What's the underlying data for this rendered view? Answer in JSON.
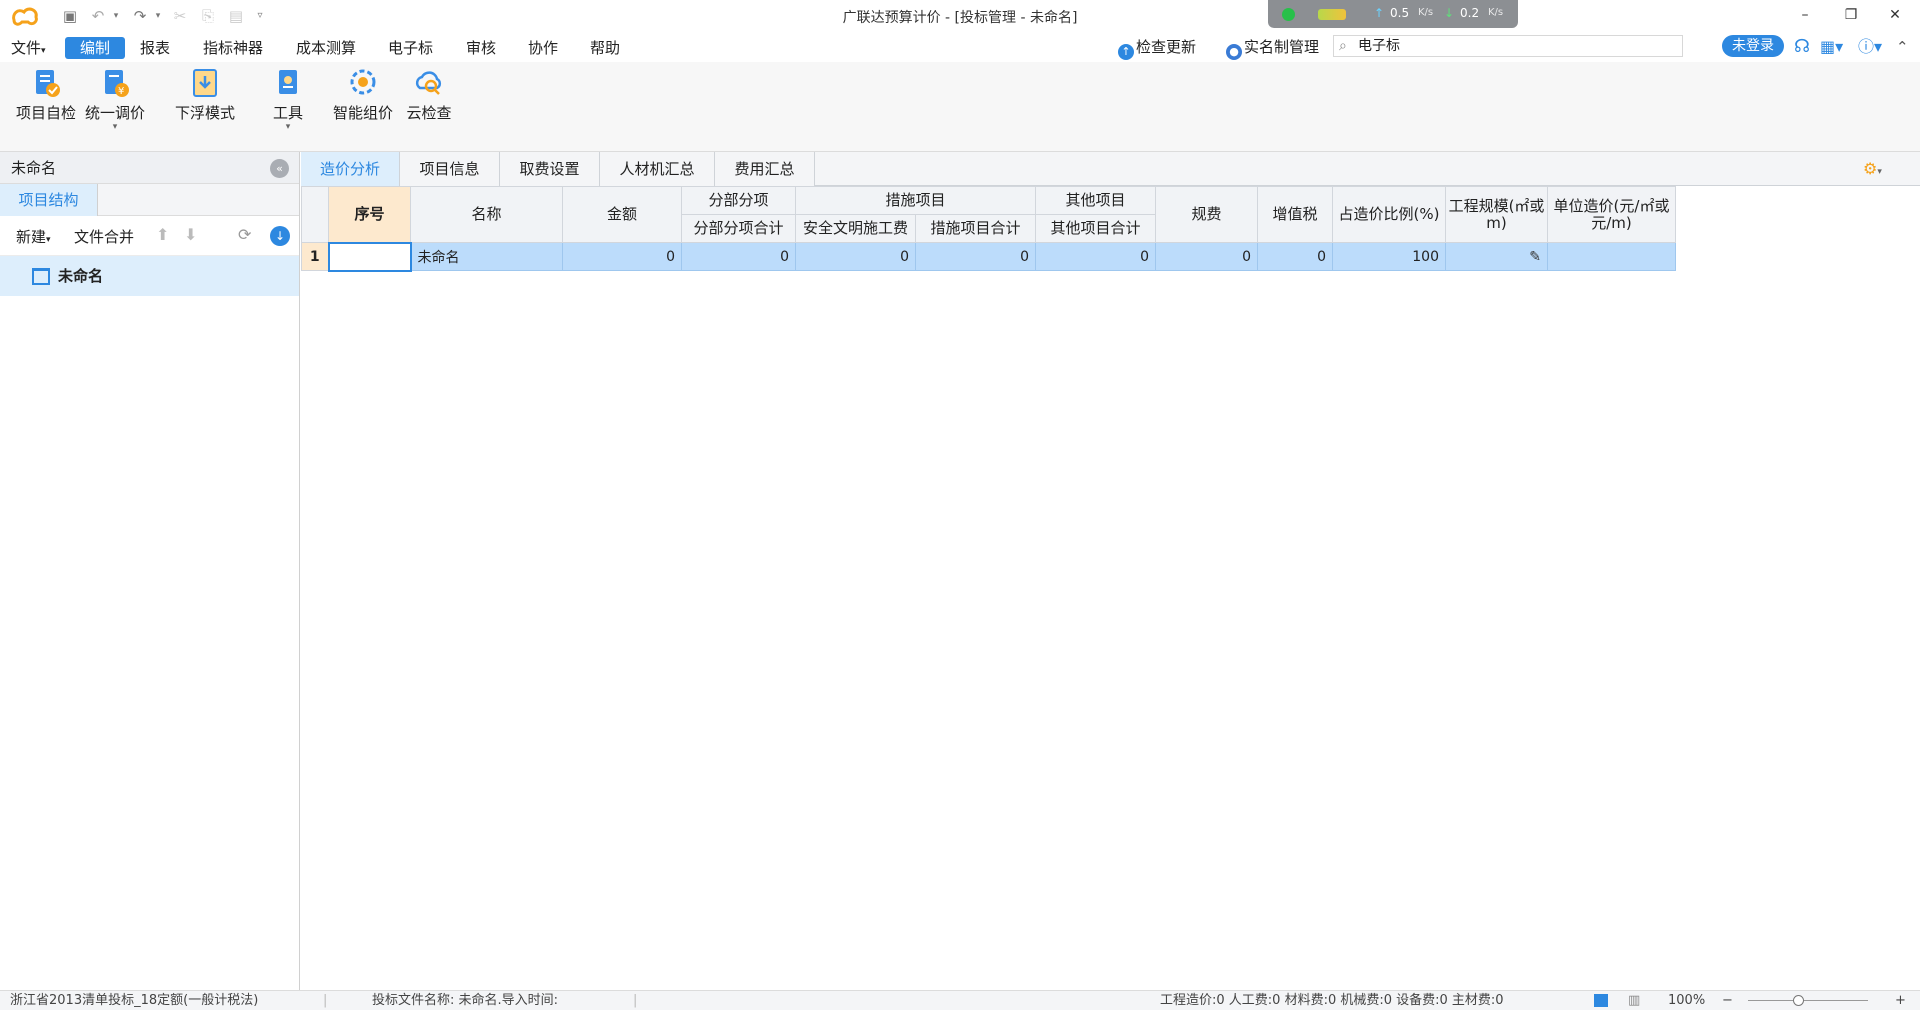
{
  "window": {
    "title": "广联达预算计价 - [投标管理 - 未命名]",
    "net_up": "0.5",
    "net_down": "0.2",
    "net_unit": "K/s"
  },
  "menus": [
    "文件",
    "编制",
    "报表",
    "指标神器",
    "成本测算",
    "电子标",
    "审核",
    "协作",
    "帮助"
  ],
  "header": {
    "check_update": "检查更新",
    "realname": "实名制管理",
    "search_value": "电子标",
    "login": "未登录"
  },
  "toolbar": {
    "self_check": "项目自检",
    "unify_price": "统一调价",
    "float_mode": "下浮模式",
    "tools": "工具",
    "smart_price": "智能组价",
    "cloud_check": "云检查"
  },
  "left_panel": {
    "title": "未命名",
    "tab": "项目结构",
    "new": "新建",
    "merge": "文件合并",
    "tree_item": "未命名"
  },
  "tabs": [
    "造价分析",
    "项目信息",
    "取费设置",
    "人材机汇总",
    "费用汇总"
  ],
  "table": {
    "headers": {
      "seq": "序号",
      "name": "名称",
      "amount": "金额",
      "fbfx": "分部分项",
      "fbfx_total": "分部分项合计",
      "measures": "措施项目",
      "safety": "安全文明施工费",
      "measures_total": "措施项目合计",
      "other": "其他项目",
      "other_total": "其他项目合计",
      "fees": "规费",
      "vat": "增值税",
      "ratio": "占造价比例(%)",
      "scale": "工程规模(㎡或m)",
      "unit_price": "单位造价(元/㎡或元/m)"
    },
    "rows": [
      {
        "no": "1",
        "seq": "",
        "name": "未命名",
        "amount": "0",
        "fbfx_total": "0",
        "safety": "0",
        "measures_total": "0",
        "other_total": "0",
        "fees": "0",
        "vat": "0",
        "ratio": "100",
        "scale": "",
        "unit_price": ""
      }
    ]
  },
  "statusbar": {
    "standard": "浙江省2013清单投标_18定额(一般计税法)",
    "file": "投标文件名称: 未命名.导入时间:",
    "summary": "工程造价:0  人工费:0  材料费:0  机械费:0  设备费:0  主材费:0",
    "zoom": "100%"
  },
  "colors": {
    "accent": "#2d88e0",
    "selected_row": "#bcdcfb",
    "seq_header": "#fde9ce"
  }
}
